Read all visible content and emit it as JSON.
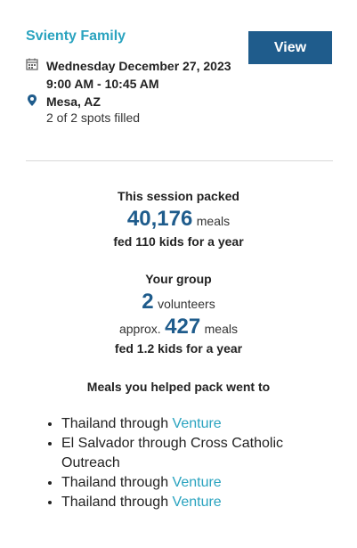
{
  "session": {
    "title": "Svienty Family",
    "view_label": "View",
    "date": "Wednesday December 27, 2023",
    "time": "9:00 AM - 10:45 AM",
    "location": "Mesa, AZ",
    "spots": "2 of 2 spots filled"
  },
  "packed": {
    "heading": "This session packed",
    "meals_count": "40,176",
    "meals_unit": "meals",
    "fed": "fed 110 kids for a year"
  },
  "group": {
    "heading": "Your group",
    "volunteers_count": "2",
    "volunteers_unit": "volunteers",
    "approx_prefix": "approx.",
    "meals_count": "427",
    "meals_unit": "meals",
    "fed": "fed 1.2 kids for a year"
  },
  "destinations": {
    "heading": "Meals you helped pack went to",
    "items": [
      {
        "text": "Thailand through ",
        "link": "Venture"
      },
      {
        "text": "El Salvador through Cross Catholic Outreach",
        "link": ""
      },
      {
        "text": "Thailand through ",
        "link": "Venture"
      },
      {
        "text": "Thailand through ",
        "link": "Venture"
      }
    ]
  }
}
